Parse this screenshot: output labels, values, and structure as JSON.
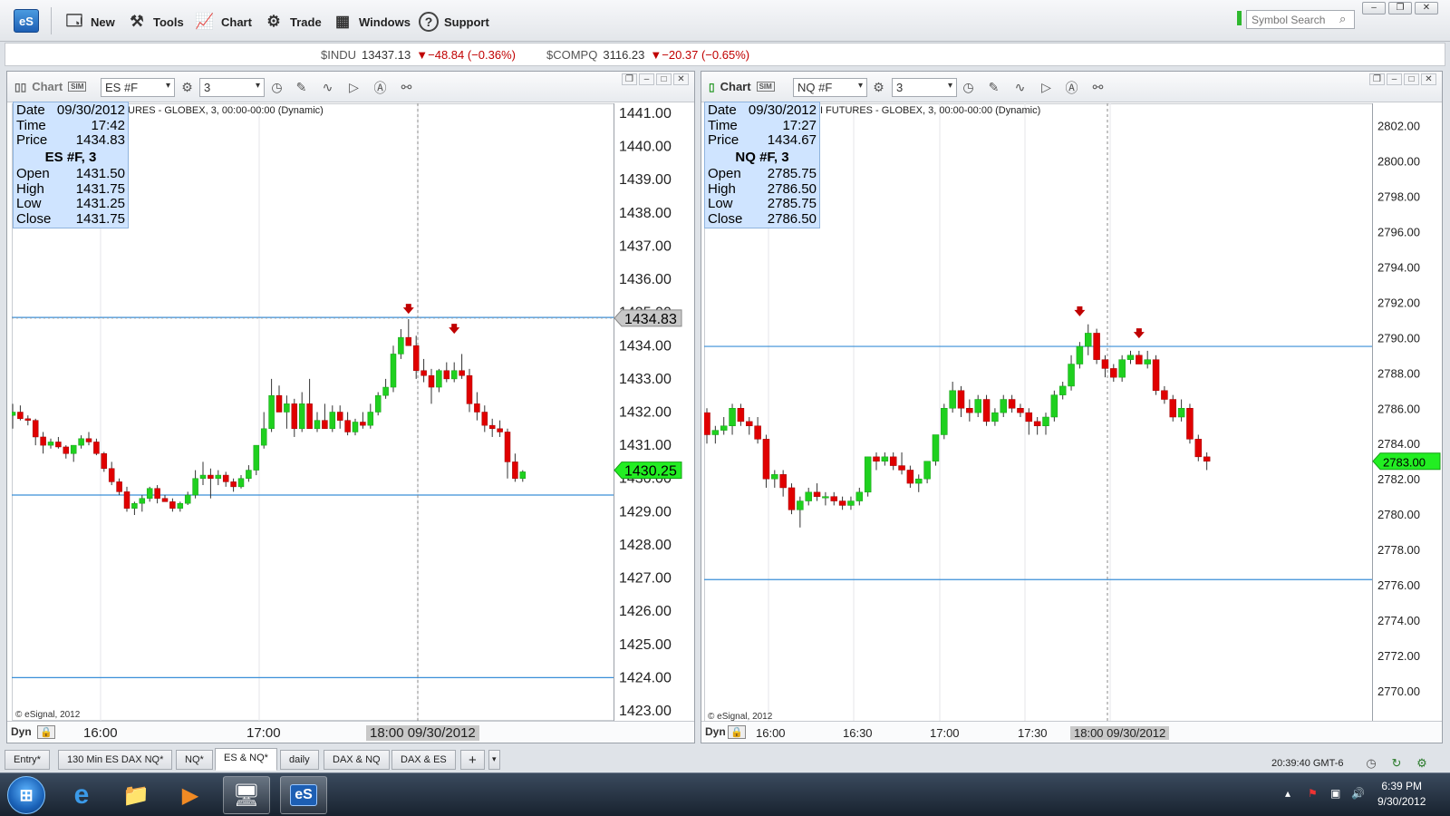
{
  "app": {
    "logo": "eS"
  },
  "toolbar": {
    "items": [
      {
        "label": "New",
        "icon": "new-window-icon"
      },
      {
        "label": "Tools",
        "icon": "tools-icon"
      },
      {
        "label": "Chart",
        "icon": "chart-icon"
      },
      {
        "label": "Trade",
        "icon": "trade-icon"
      },
      {
        "label": "Windows",
        "icon": "windows-icon"
      },
      {
        "label": "Support",
        "icon": "help-icon"
      }
    ],
    "search_placeholder": "Symbol Search"
  },
  "ticker": [
    {
      "symbol": "$INDU",
      "value": "13437.13",
      "change": "▼−48.84 (−0.36%)"
    },
    {
      "symbol": "$COMPQ",
      "value": "3116.23",
      "change": "▼−20.37 (−0.65%)"
    }
  ],
  "panes": {
    "left": {
      "title": "Chart",
      "symbol": "ES #F",
      "interval": "3",
      "description": "URES - GLOBEX, 3, 00:00-00:00 (Dynamic)",
      "copyright": "© eSignal, 2012",
      "dyn": "Dyn",
      "info": {
        "date_label": "Date",
        "date": "09/30/2012",
        "time_label": "Time",
        "time": "17:42",
        "price_label": "Price",
        "price": "1434.83",
        "symbol_interval": "ES #F, 3",
        "open_label": "Open",
        "open": "1431.50",
        "high_label": "High",
        "high": "1431.75",
        "low_label": "Low",
        "low": "1431.25",
        "close_label": "Close",
        "close": "1431.75"
      },
      "x_labels": [
        "16:00",
        "17:00"
      ],
      "x_highlight": "18:00 09/30/2012",
      "cursor_price": "1434.83",
      "last_price": "1430.25"
    },
    "right": {
      "title": "Chart",
      "symbol": "NQ #F",
      "interval": "3",
      "description": "NI FUTURES - GLOBEX, 3, 00:00-00:00 (Dynamic)",
      "copyright": "© eSignal, 2012",
      "dyn": "Dyn",
      "info": {
        "date_label": "Date",
        "date": "09/30/2012",
        "time_label": "Time",
        "time": "17:27",
        "price_label": "Price",
        "price": "1434.67",
        "symbol_interval": "NQ #F, 3",
        "open_label": "Open",
        "open": "2785.75",
        "high_label": "High",
        "high": "2786.50",
        "low_label": "Low",
        "low": "2785.75",
        "close_label": "Close",
        "close": "2786.50"
      },
      "x_labels": [
        "16:00",
        "16:30",
        "17:00",
        "17:30"
      ],
      "x_highlight": "18:00 09/30/2012",
      "last_price": "2783.00"
    }
  },
  "chart_data": [
    {
      "type": "candlestick",
      "title": "ES #F, 3",
      "ylim": [
        1423,
        1441
      ],
      "y_ticks": [
        "1441.00",
        "1440.00",
        "1439.00",
        "1438.00",
        "1437.00",
        "1436.00",
        "1435.00",
        "1434.00",
        "1433.00",
        "1432.00",
        "1431.00",
        "1430.00",
        "1429.00",
        "1428.00",
        "1427.00",
        "1426.00",
        "1425.00",
        "1424.00",
        "1423.00"
      ],
      "x_ticks": [
        "16:00",
        "17:00",
        "18:00 09/30/2012"
      ],
      "hlines": [
        1434.85,
        1429.5,
        1424.0
      ],
      "ohlc": [
        [
          1431.9,
          1432.25,
          1431.5,
          1432.0
        ],
        [
          1432.0,
          1432.2,
          1431.75,
          1431.8
        ],
        [
          1431.8,
          1431.9,
          1431.6,
          1431.75
        ],
        [
          1431.75,
          1431.8,
          1431.0,
          1431.25
        ],
        [
          1431.25,
          1431.4,
          1430.75,
          1431.0
        ],
        [
          1431.0,
          1431.2,
          1430.9,
          1431.1
        ],
        [
          1431.1,
          1431.25,
          1430.9,
          1430.95
        ],
        [
          1430.95,
          1431.0,
          1430.6,
          1430.75
        ],
        [
          1430.75,
          1431.0,
          1430.5,
          1431.0
        ],
        [
          1431.0,
          1431.3,
          1430.9,
          1431.2
        ],
        [
          1431.2,
          1431.4,
          1431.0,
          1431.1
        ],
        [
          1431.1,
          1431.2,
          1430.7,
          1430.75
        ],
        [
          1430.75,
          1430.8,
          1430.2,
          1430.3
        ],
        [
          1430.3,
          1430.5,
          1429.8,
          1429.9
        ],
        [
          1429.9,
          1430.0,
          1429.5,
          1429.6
        ],
        [
          1429.6,
          1429.75,
          1429.0,
          1429.1
        ],
        [
          1429.1,
          1429.3,
          1428.9,
          1429.25
        ],
        [
          1429.25,
          1429.5,
          1429.0,
          1429.4
        ],
        [
          1429.4,
          1429.75,
          1429.3,
          1429.7
        ],
        [
          1429.7,
          1429.8,
          1429.25,
          1429.4
        ],
        [
          1429.4,
          1429.5,
          1429.3,
          1429.3
        ],
        [
          1429.3,
          1429.4,
          1429.0,
          1429.1
        ],
        [
          1429.1,
          1429.3,
          1429.0,
          1429.25
        ],
        [
          1429.25,
          1429.6,
          1429.2,
          1429.5
        ],
        [
          1429.5,
          1430.25,
          1429.4,
          1430.0
        ],
        [
          1430.0,
          1430.5,
          1429.8,
          1430.1
        ],
        [
          1430.1,
          1430.3,
          1429.4,
          1430.0
        ],
        [
          1430.0,
          1430.25,
          1429.8,
          1430.1
        ],
        [
          1430.1,
          1430.2,
          1429.75,
          1429.9
        ],
        [
          1429.9,
          1430.0,
          1429.6,
          1429.75
        ],
        [
          1429.75,
          1430.1,
          1429.7,
          1430.0
        ],
        [
          1430.0,
          1430.4,
          1429.9,
          1430.25
        ],
        [
          1430.25,
          1431.0,
          1430.1,
          1431.0
        ],
        [
          1431.0,
          1432.0,
          1430.9,
          1431.5
        ],
        [
          1431.5,
          1433.0,
          1431.4,
          1432.5
        ],
        [
          1432.5,
          1432.8,
          1432.0,
          1432.0
        ],
        [
          1432.0,
          1432.5,
          1431.5,
          1432.25
        ],
        [
          1432.25,
          1432.4,
          1431.25,
          1431.5
        ],
        [
          1431.5,
          1432.6,
          1431.4,
          1432.25
        ],
        [
          1432.25,
          1433.0,
          1431.5,
          1431.5
        ],
        [
          1431.5,
          1432.0,
          1431.4,
          1431.75
        ],
        [
          1431.75,
          1432.25,
          1431.5,
          1431.5
        ],
        [
          1431.5,
          1432.2,
          1431.4,
          1432.0
        ],
        [
          1432.0,
          1432.2,
          1431.5,
          1431.75
        ],
        [
          1431.75,
          1432.0,
          1431.3,
          1431.4
        ],
        [
          1431.4,
          1431.8,
          1431.3,
          1431.7
        ],
        [
          1431.7,
          1432.0,
          1431.5,
          1431.6
        ],
        [
          1431.6,
          1432.25,
          1431.5,
          1432.0
        ],
        [
          1432.0,
          1432.6,
          1431.9,
          1432.5
        ],
        [
          1432.5,
          1433.0,
          1432.4,
          1432.75
        ],
        [
          1432.75,
          1434.0,
          1432.6,
          1433.75
        ],
        [
          1433.75,
          1434.5,
          1433.6,
          1434.25
        ],
        [
          1434.25,
          1434.8,
          1434.0,
          1434.0
        ],
        [
          1434.0,
          1434.3,
          1433.0,
          1433.25
        ],
        [
          1433.25,
          1433.6,
          1432.9,
          1433.1
        ],
        [
          1433.1,
          1433.3,
          1432.25,
          1432.75
        ],
        [
          1432.75,
          1433.3,
          1432.6,
          1433.25
        ],
        [
          1433.25,
          1433.5,
          1432.9,
          1433.0
        ],
        [
          1433.0,
          1433.5,
          1432.9,
          1433.25
        ],
        [
          1433.25,
          1433.75,
          1433.0,
          1433.1
        ],
        [
          1433.1,
          1433.3,
          1432.0,
          1432.25
        ],
        [
          1432.25,
          1432.6,
          1431.75,
          1432.0
        ],
        [
          1432.0,
          1432.2,
          1431.4,
          1431.6
        ],
        [
          1431.6,
          1431.8,
          1431.25,
          1431.5
        ],
        [
          1431.5,
          1431.75,
          1431.25,
          1431.4
        ],
        [
          1431.4,
          1431.5,
          1430.0,
          1430.5
        ],
        [
          1430.5,
          1430.75,
          1429.9,
          1430.0
        ],
        [
          1430.0,
          1430.25,
          1429.9,
          1430.2
        ]
      ],
      "markers": [
        {
          "bar": 52,
          "price": 1434.85
        },
        {
          "bar": 58,
          "price": 1434.25
        }
      ]
    },
    {
      "type": "candlestick",
      "title": "NQ #F, 3",
      "ylim": [
        2768,
        2803
      ],
      "y_ticks": [
        "2802.00",
        "2800.00",
        "2798.00",
        "2796.00",
        "2794.00",
        "2792.00",
        "2790.00",
        "2788.00",
        "2786.00",
        "2784.00",
        "2782.00",
        "2780.00",
        "2778.00",
        "2776.00",
        "2774.00",
        "2772.00",
        "2770.00"
      ],
      "x_ticks": [
        "16:00",
        "16:30",
        "17:00",
        "17:30",
        "18:00 09/30/2012"
      ],
      "hlines": [
        2789.5,
        2776.3
      ],
      "ohlc": [
        [
          2785.75,
          2786.0,
          2784.0,
          2784.5
        ],
        [
          2784.5,
          2785.0,
          2784.0,
          2784.75
        ],
        [
          2784.75,
          2785.5,
          2784.5,
          2785.0
        ],
        [
          2785.0,
          2786.25,
          2784.5,
          2786.0
        ],
        [
          2786.0,
          2786.25,
          2785.0,
          2785.25
        ],
        [
          2785.25,
          2785.5,
          2784.5,
          2785.0
        ],
        [
          2785.0,
          2785.5,
          2784.0,
          2784.25
        ],
        [
          2784.25,
          2784.5,
          2781.5,
          2782.0
        ],
        [
          2782.0,
          2782.5,
          2781.5,
          2782.25
        ],
        [
          2782.25,
          2782.5,
          2781.0,
          2781.5
        ],
        [
          2781.5,
          2781.75,
          2780.0,
          2780.25
        ],
        [
          2780.25,
          2781.0,
          2779.25,
          2780.75
        ],
        [
          2780.75,
          2781.5,
          2780.5,
          2781.25
        ],
        [
          2781.25,
          2781.75,
          2780.75,
          2781.0
        ],
        [
          2781.0,
          2781.25,
          2780.5,
          2781.0
        ],
        [
          2781.0,
          2781.25,
          2780.5,
          2780.75
        ],
        [
          2780.75,
          2781.0,
          2780.25,
          2780.5
        ],
        [
          2780.5,
          2781.0,
          2780.25,
          2780.75
        ],
        [
          2780.75,
          2781.5,
          2780.5,
          2781.25
        ],
        [
          2781.25,
          2783.25,
          2781.0,
          2783.25
        ],
        [
          2783.25,
          2783.5,
          2782.5,
          2783.0
        ],
        [
          2783.0,
          2783.5,
          2782.75,
          2783.25
        ],
        [
          2783.25,
          2783.5,
          2782.5,
          2782.75
        ],
        [
          2782.75,
          2783.5,
          2782.25,
          2782.5
        ],
        [
          2782.5,
          2782.75,
          2781.5,
          2781.75
        ],
        [
          2781.75,
          2782.25,
          2781.25,
          2782.0
        ],
        [
          2782.0,
          2783.0,
          2781.75,
          2783.0
        ],
        [
          2783.0,
          2784.5,
          2782.75,
          2784.5
        ],
        [
          2784.5,
          2786.25,
          2784.25,
          2786.0
        ],
        [
          2786.0,
          2787.5,
          2785.75,
          2787.0
        ],
        [
          2787.0,
          2787.25,
          2785.5,
          2786.0
        ],
        [
          2786.0,
          2786.5,
          2785.25,
          2785.75
        ],
        [
          2785.75,
          2786.75,
          2785.5,
          2786.5
        ],
        [
          2786.5,
          2786.75,
          2785.0,
          2785.25
        ],
        [
          2785.25,
          2786.0,
          2785.0,
          2785.75
        ],
        [
          2785.75,
          2786.75,
          2785.5,
          2786.5
        ],
        [
          2786.5,
          2786.75,
          2785.75,
          2786.0
        ],
        [
          2786.0,
          2786.25,
          2785.5,
          2785.75
        ],
        [
          2785.75,
          2786.0,
          2784.5,
          2785.25
        ],
        [
          2785.25,
          2785.5,
          2784.5,
          2785.0
        ],
        [
          2785.0,
          2785.75,
          2784.5,
          2785.5
        ],
        [
          2785.5,
          2787.0,
          2785.25,
          2786.75
        ],
        [
          2786.75,
          2787.5,
          2786.5,
          2787.25
        ],
        [
          2787.25,
          2789.0,
          2787.0,
          2788.5
        ],
        [
          2788.5,
          2789.75,
          2788.25,
          2789.5
        ],
        [
          2789.5,
          2790.75,
          2789.0,
          2790.25
        ],
        [
          2790.25,
          2790.5,
          2788.5,
          2788.75
        ],
        [
          2788.75,
          2789.0,
          2787.75,
          2788.25
        ],
        [
          2788.25,
          2788.5,
          2787.5,
          2787.75
        ],
        [
          2787.75,
          2789.0,
          2787.5,
          2788.75
        ],
        [
          2788.75,
          2789.25,
          2788.5,
          2789.0
        ],
        [
          2789.0,
          2789.25,
          2788.5,
          2788.5
        ],
        [
          2788.5,
          2789.25,
          2788.25,
          2788.75
        ],
        [
          2788.75,
          2789.0,
          2786.75,
          2787.0
        ],
        [
          2787.0,
          2787.25,
          2786.25,
          2786.5
        ],
        [
          2786.5,
          2786.75,
          2785.25,
          2785.5
        ],
        [
          2785.5,
          2786.5,
          2785.25,
          2786.0
        ],
        [
          2786.0,
          2786.25,
          2784.0,
          2784.25
        ],
        [
          2784.25,
          2784.5,
          2783.0,
          2783.25
        ],
        [
          2783.25,
          2783.5,
          2782.5,
          2783.0
        ]
      ],
      "markers": [
        {
          "bar": 44,
          "price": 2791.0
        },
        {
          "bar": 51,
          "price": 2789.75
        }
      ]
    }
  ],
  "tabs": [
    "Entry*",
    "130 Min ES DAX NQ*",
    "NQ*",
    "ES & NQ*",
    "daily",
    "DAX & NQ",
    "DAX & ES"
  ],
  "active_tab": "ES & NQ*",
  "status": {
    "clock": "20:39:40 GMT-6"
  },
  "taskbar": {
    "time": "6:39 PM",
    "date": "9/30/2012",
    "active_app": "eS"
  }
}
